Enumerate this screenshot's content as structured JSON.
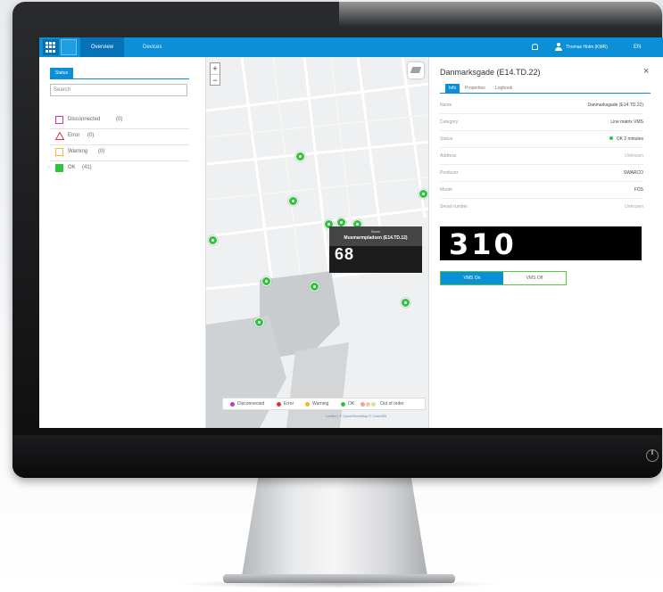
{
  "nav": {
    "tabs": [
      {
        "label": "Overview"
      },
      {
        "label": "Devices"
      }
    ],
    "user": "Thomas Holm (KMR)",
    "language": "EN"
  },
  "status_panel": {
    "tab_label": "Status",
    "search_placeholder": "Search",
    "items": [
      {
        "label": "Disconnected",
        "count": "(0)",
        "color": "#c03ab9"
      },
      {
        "label": "Error",
        "count": "(0)",
        "color": "#e0343a"
      },
      {
        "label": "Warning",
        "count": "(0)",
        "color": "#f2b632"
      },
      {
        "label": "OK",
        "count": "(41)",
        "color": "#2fc43d"
      }
    ]
  },
  "map": {
    "zoom_in": "+",
    "zoom_out": "−",
    "popup": {
      "label": "Name",
      "name": "Musmarmpladsen (E14.TD.12)",
      "value": "68"
    },
    "legend": [
      {
        "label": "Disconnected",
        "color": "#c03ab9"
      },
      {
        "label": "Error",
        "color": "#e0343a"
      },
      {
        "label": "Warning",
        "color": "#f2b632"
      },
      {
        "label": "OK",
        "color": "#2fc43d"
      },
      {
        "label": "Out of order",
        "color": "#f0a0a0"
      }
    ],
    "attribution": "Leaflet | © OpenStreetMap © CartoDB"
  },
  "detail": {
    "title": "Danmarksgade (E14.TD.22)",
    "close": "×",
    "tabs": [
      {
        "label": "Info"
      },
      {
        "label": "Properties"
      },
      {
        "label": "Logbook"
      }
    ],
    "rows": [
      {
        "key": "Name",
        "value": "Danmarksgade (E14.TD.22)"
      },
      {
        "key": "Category",
        "value": "Line matrix VMS"
      },
      {
        "key": "Status",
        "value": "OK 2 minutes"
      },
      {
        "key": "Address",
        "value": "Unknown"
      },
      {
        "key": "Producer",
        "value": "SWARCO"
      },
      {
        "key": "Model",
        "value": "FOS"
      },
      {
        "key": "Serial number",
        "value": "Unknown"
      }
    ],
    "sign_value": "310",
    "vms_on": "VMS On",
    "vms_off": "VMS Off"
  }
}
